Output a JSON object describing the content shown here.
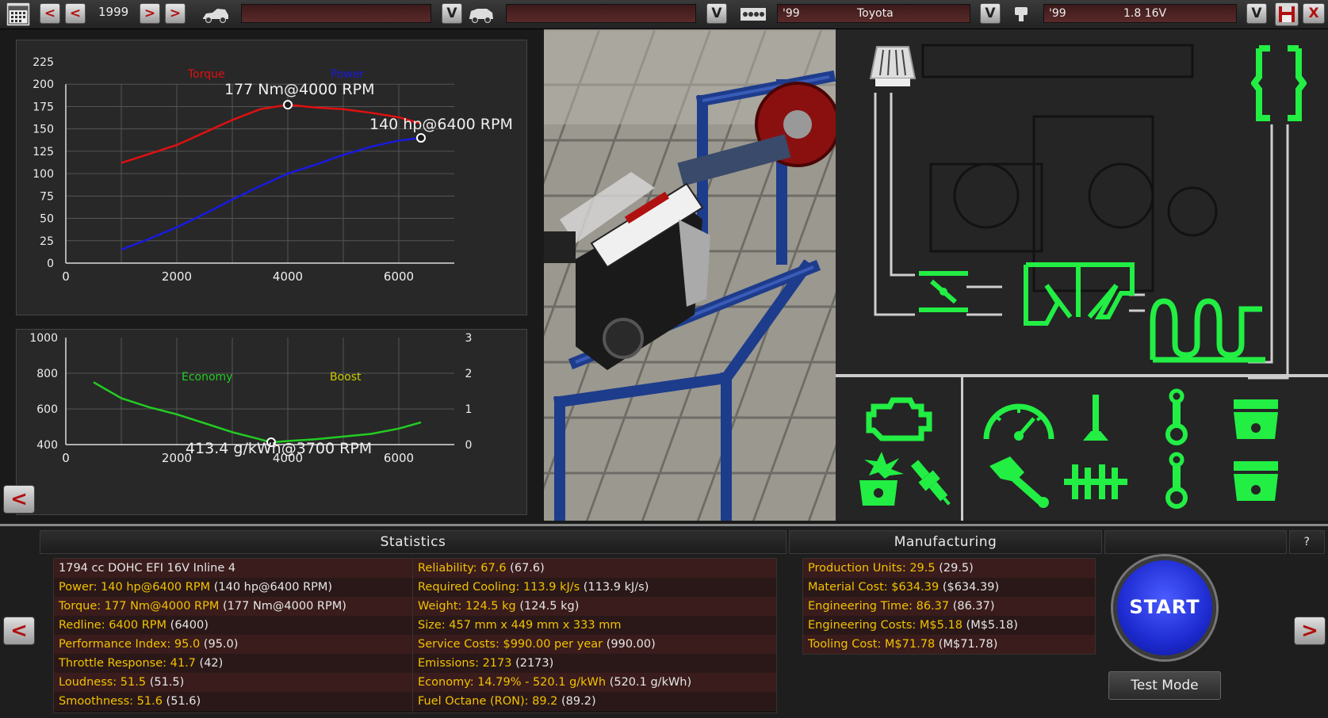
{
  "topbar": {
    "year": "1999",
    "model_year": "'99",
    "brand": "Toyota",
    "engine_year": "'99",
    "engine_name": "1.8 16V",
    "dropdown_glyph": "V",
    "arrow_left": "<",
    "arrow_right": ">",
    "close_glyph": "X"
  },
  "power_chart": {
    "legend_torque": "Torque",
    "legend_power": "Power",
    "torque_peak_label": "177 Nm@4000 RPM",
    "power_peak_label": "140 hp@6400 RPM",
    "y_ticks": [
      "225",
      "200",
      "175",
      "150",
      "125",
      "100",
      "75",
      "50",
      "25",
      "0"
    ],
    "x_ticks": [
      "0",
      "2000",
      "4000",
      "6000"
    ]
  },
  "economy_chart": {
    "legend_economy": "Economy",
    "legend_boost": "Boost",
    "min_label": "413.4 g/kWh@3700 RPM",
    "y_ticks_left": [
      "1000",
      "800",
      "600",
      "400"
    ],
    "y_ticks_right": [
      "3",
      "2",
      "1",
      "0"
    ],
    "x_ticks": [
      "0",
      "2000",
      "4000",
      "6000"
    ]
  },
  "chart_data": [
    {
      "type": "line",
      "xlim": [
        0,
        7000
      ],
      "ylim": [
        0,
        225
      ],
      "grid": true,
      "series": [
        {
          "name": "Torque",
          "color": "#e01010",
          "x": [
            1000,
            1500,
            2000,
            2500,
            3000,
            3500,
            4000,
            4500,
            5000,
            5500,
            6000,
            6400
          ],
          "y": [
            112,
            122,
            132,
            146,
            160,
            172,
            177,
            174,
            172,
            168,
            163,
            156
          ]
        },
        {
          "name": "Power",
          "color": "#1a1ae0",
          "x": [
            1000,
            1500,
            2000,
            2500,
            3000,
            3500,
            4000,
            4500,
            5000,
            5500,
            6000,
            6400
          ],
          "y": [
            15,
            27,
            40,
            55,
            71,
            86,
            100,
            110,
            121,
            130,
            137,
            140
          ]
        }
      ],
      "annotations": [
        {
          "text": "177 Nm@4000 RPM",
          "x": 4000,
          "y": 177
        },
        {
          "text": "140 hp@6400 RPM",
          "x": 6400,
          "y": 140
        }
      ]
    },
    {
      "type": "line",
      "xlim": [
        0,
        7000
      ],
      "ylim": [
        400,
        1000
      ],
      "y2lim": [
        0,
        3
      ],
      "grid": true,
      "series": [
        {
          "name": "Economy",
          "color": "#22cc22",
          "x": [
            500,
            1000,
            1500,
            2000,
            2500,
            3000,
            3500,
            3700,
            4000,
            4500,
            5000,
            5500,
            6000,
            6400
          ],
          "y": [
            750,
            660,
            610,
            570,
            520,
            470,
            430,
            413,
            420,
            430,
            445,
            460,
            490,
            525
          ]
        }
      ],
      "annotations": [
        {
          "text": "413.4 g/kWh@3700 RPM",
          "x": 3700,
          "y": 413.4
        }
      ]
    }
  ],
  "statistics": {
    "title": "Statistics",
    "left": [
      {
        "k": "1794 cc DOHC EFI 16V Inline 4",
        "v": "",
        "plain": true
      },
      {
        "k": "Power: 140 hp@6400 RPM",
        "v": " (140 hp@6400 RPM)"
      },
      {
        "k": "Torque: 177 Nm@4000 RPM",
        "v": " (177 Nm@4000 RPM)"
      },
      {
        "k": "Redline: 6400 RPM",
        "v": " (6400)"
      },
      {
        "k": "Performance Index: 95.0",
        "v": " (95.0)"
      },
      {
        "k": "Throttle Response: 41.7",
        "v": " (42)"
      },
      {
        "k": "Loudness: 51.5",
        "v": " (51.5)"
      },
      {
        "k": "Smoothness: 51.6",
        "v": " (51.6)"
      }
    ],
    "right": [
      {
        "k": "Reliability: 67.6",
        "v": " (67.6)"
      },
      {
        "k": "Required Cooling: 113.9 kJ/s",
        "v": " (113.9 kJ/s)"
      },
      {
        "k": "Weight: 124.5 kg",
        "v": " (124.5 kg)"
      },
      {
        "k": "Size: 457 mm x 449 mm x 333 mm",
        "v": ""
      },
      {
        "k": "Service Costs: $990.00 per year",
        "v": " (990.00)"
      },
      {
        "k": "Emissions: 2173",
        "v": " (2173)"
      },
      {
        "k": "Economy: 14.79% - 520.1 g/kWh",
        "v": " (520.1 g/kWh)"
      },
      {
        "k": "Fuel Octane (RON): 89.2",
        "v": " (89.2)"
      }
    ]
  },
  "manufacturing": {
    "title": "Manufacturing",
    "rows": [
      {
        "k": "Production Units: 29.5",
        "v": " (29.5)"
      },
      {
        "k": "Material Cost: $634.39",
        "v": " ($634.39)"
      },
      {
        "k": "Engineering Time: 86.37",
        "v": " (86.37)"
      },
      {
        "k": "Engineering Costs: M$5.18",
        "v": " (M$5.18)"
      },
      {
        "k": "Tooling Cost: M$71.78",
        "v": " (M$71.78)"
      }
    ]
  },
  "controls": {
    "help": "?",
    "start": "START",
    "test_mode": "Test Mode",
    "prev": "<",
    "next": ">"
  },
  "colors": {
    "torque": "#e01010",
    "power": "#1a1ae0",
    "economy": "#22cc22",
    "boost": "#cccc00",
    "schematic_green": "#22ee44",
    "label_yellow": "#f2c200"
  }
}
